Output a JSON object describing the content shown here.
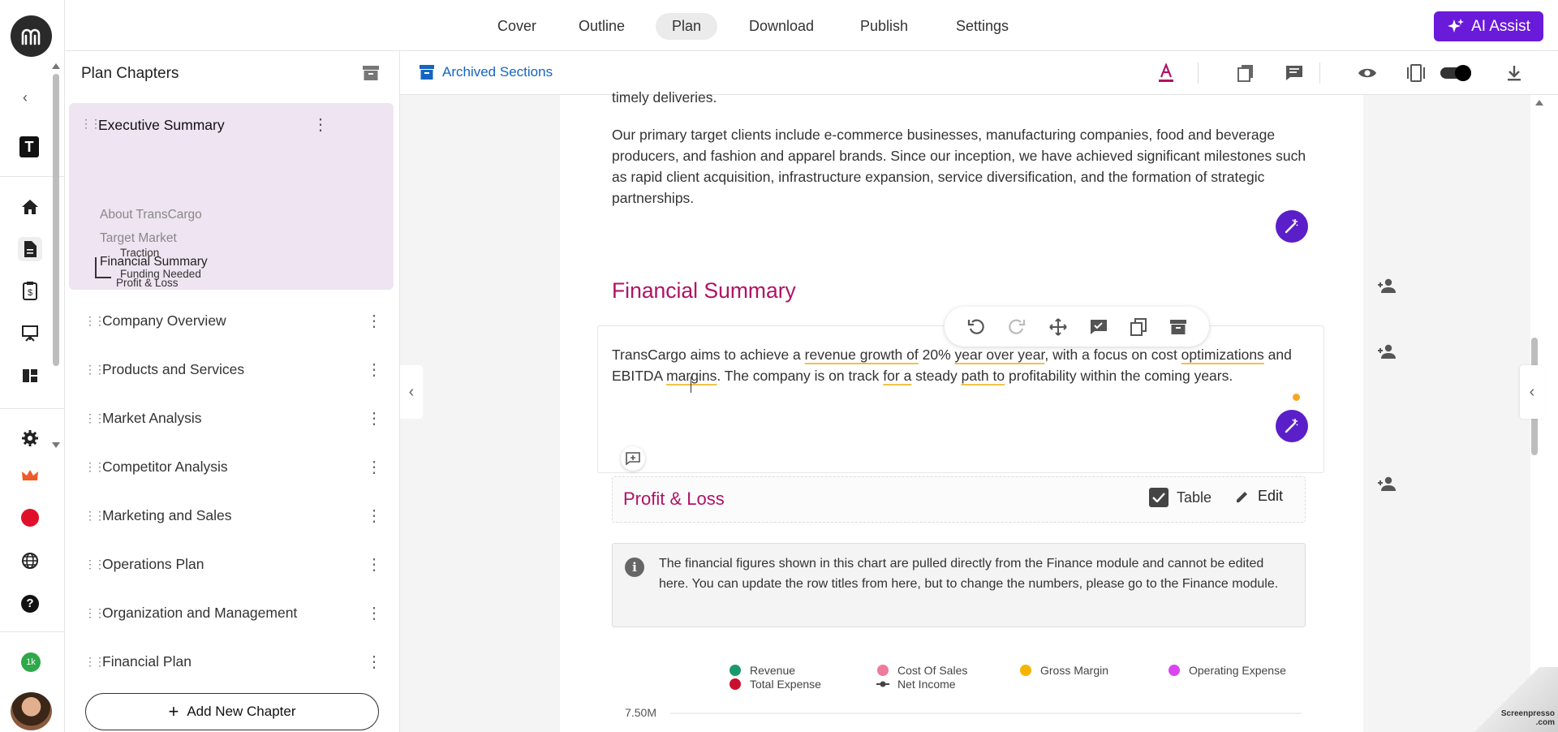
{
  "rail": {
    "brand_letter": "T",
    "badge_count": "1k"
  },
  "nav": {
    "tabs": [
      "Cover",
      "Outline",
      "Plan",
      "Download",
      "Publish",
      "Settings"
    ],
    "active_tab": "Plan",
    "ai_label": "AI Assist"
  },
  "chapters": {
    "title": "Plan Chapters",
    "active": {
      "label": "Executive Summary",
      "sections": [
        "About TransCargo",
        "Target Market",
        "Financial Summary"
      ],
      "subsections": [
        "Profit & Loss",
        "Traction",
        "Funding Needed"
      ]
    },
    "items": [
      "Company Overview",
      "Products and Services",
      "Market Analysis",
      "Competitor Analysis",
      "Marketing and Sales",
      "Operations Plan",
      "Organization and Management",
      "Financial Plan"
    ],
    "add_label": "Add New Chapter"
  },
  "toolbar": {
    "archived_label": "Archived Sections"
  },
  "doc": {
    "top_fragment": "timely deliveries.",
    "para1": "Our primary target clients include e-commerce businesses, manufacturing companies, food and beverage producers, and fashion and apparel brands. Since our inception, we have achieved significant milestones such as rapid client acquisition, infrastructure expansion, service diversification, and the formation of strategic partnerships.",
    "section_heading": "Financial Summary",
    "para2": {
      "s1": "TransCargo aims to achieve a ",
      "u1": "revenue growth of",
      "s2": " 20% ",
      "u2": "year over year",
      "s3": ", with a focus on cost ",
      "u3": "optimizations",
      "s4": " and EBITDA ",
      "u4": "margins",
      "s5": ". The company is on track ",
      "u5": "for a",
      "s6": " steady ",
      "u6": "path to",
      "s7": " profitability within the coming years."
    },
    "pl_heading": "Profit & Loss",
    "table_label": "Table",
    "table_checked": true,
    "edit_label": "Edit",
    "info_text": "The financial figures shown in this chart are pulled directly from the Finance module and cannot be edited here. You can update the row titles from here, but to change the numbers, please go to the Finance module."
  },
  "chart_data": {
    "type": "bar",
    "series": [
      {
        "name": "Revenue",
        "color": "#1a9a6c"
      },
      {
        "name": "Cost Of Sales",
        "color": "#ee7a9c"
      },
      {
        "name": "Gross Margin",
        "color": "#f5b400"
      },
      {
        "name": "Operating Expense",
        "color": "#d946ef"
      },
      {
        "name": "Total Expense",
        "color": "#c8102e"
      },
      {
        "name": "Net Income",
        "color": "#444444"
      }
    ],
    "y_ticks": [
      "7.50M"
    ]
  },
  "watermark": "Screenpresso .com"
}
